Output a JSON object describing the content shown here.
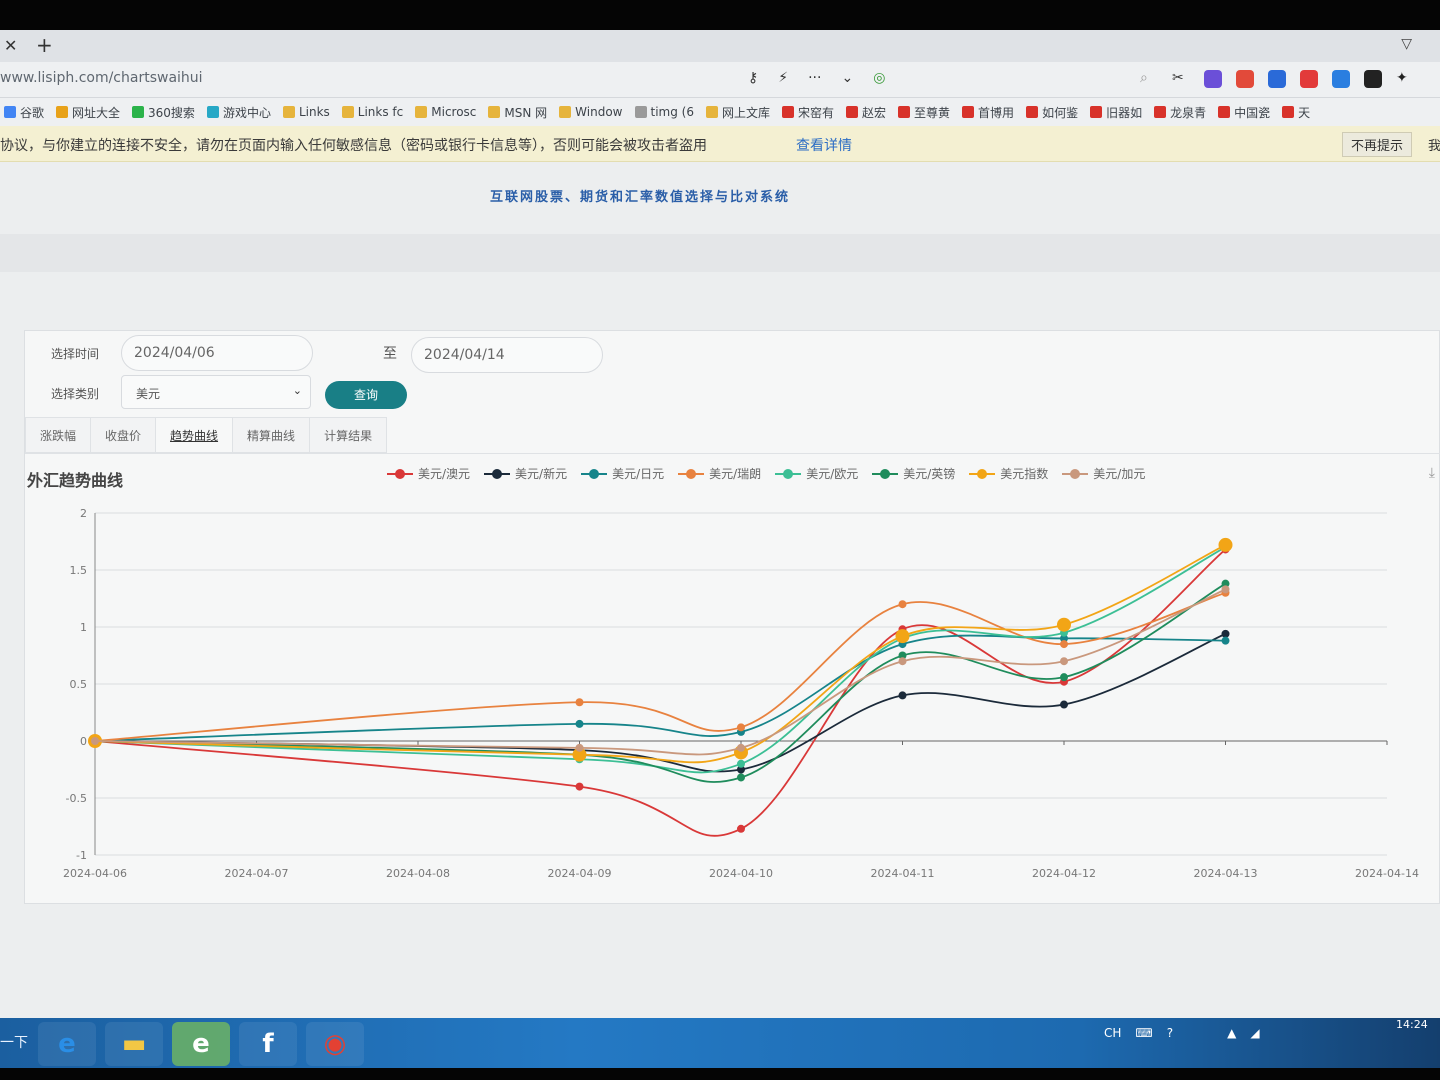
{
  "browser": {
    "url": "www.lisiph.com/chartswaihui",
    "new_tab": "+",
    "bookmarks": [
      {
        "label": "谷歌",
        "color": "#4285f4"
      },
      {
        "label": "网址大全",
        "color": "#e8a21a"
      },
      {
        "label": "360搜索",
        "color": "#2bb34a"
      },
      {
        "label": "游戏中心",
        "color": "#27a8c6"
      },
      {
        "label": "Links",
        "color": "#e6b43c"
      },
      {
        "label": "Links fc",
        "color": "#e6b43c"
      },
      {
        "label": "Microsc",
        "color": "#e6b43c"
      },
      {
        "label": "MSN 网",
        "color": "#e6b43c"
      },
      {
        "label": "Window",
        "color": "#e6b43c"
      },
      {
        "label": "timg (6",
        "color": "#9a9a9a"
      },
      {
        "label": "网上文库",
        "color": "#e6b43c"
      },
      {
        "label": "宋窑有",
        "color": "#d8322a"
      },
      {
        "label": "赵宏",
        "color": "#d8322a"
      },
      {
        "label": "至尊黄",
        "color": "#d8322a"
      },
      {
        "label": "首博用",
        "color": "#d8322a"
      },
      {
        "label": "如何鉴",
        "color": "#d8322a"
      },
      {
        "label": "旧器如",
        "color": "#d8322a"
      },
      {
        "label": "龙泉青",
        "color": "#d8322a"
      },
      {
        "label": "中国瓷",
        "color": "#d8322a"
      },
      {
        "label": "天",
        "color": "#d8322a"
      }
    ],
    "warning": {
      "text": "协议，与你建立的连接不安全，请勿在页面内输入任何敏感信息（密码或银行卡信息等），否则可能会被攻击者盗用",
      "link": "查看详情",
      "dismiss": "不再提示",
      "more": "我"
    }
  },
  "page": {
    "system_title": "互联网股票、期货和汇率数值选择与比对系统",
    "filters": {
      "time_label": "选择时间",
      "start_date": "2024/04/06",
      "to_label": "至",
      "end_date": "2024/04/14",
      "category_label": "选择类别",
      "category_value": "美元",
      "query_button": "查询"
    },
    "tabs": [
      "涨跌幅",
      "收盘价",
      "趋势曲线",
      "精算曲线",
      "计算结果"
    ],
    "active_tab": 2,
    "chart_title": "外汇趋势曲线"
  },
  "chart_data": {
    "type": "line",
    "title": "外汇趋势曲线",
    "x": [
      "2024-04-06",
      "2024-04-07",
      "2024-04-08",
      "2024-04-09",
      "2024-04-10",
      "2024-04-11",
      "2024-04-12",
      "2024-04-13",
      "2024-04-14"
    ],
    "ylim": [
      -1,
      2
    ],
    "yticks": [
      2,
      1.5,
      1,
      0.5,
      0,
      -0.5,
      -1
    ],
    "grid": true,
    "legend_position": "top",
    "series": [
      {
        "name": "美元/澳元",
        "color": "#d93838",
        "points": [
          [
            "2024-04-06",
            0
          ],
          [
            "2024-04-09",
            -0.4
          ],
          [
            "2024-04-10",
            -0.77
          ],
          [
            "2024-04-11",
            0.98
          ],
          [
            "2024-04-12",
            0.52
          ],
          [
            "2024-04-13",
            1.68
          ]
        ]
      },
      {
        "name": "美元/新元",
        "color": "#1b2a3a",
        "points": [
          [
            "2024-04-06",
            0
          ],
          [
            "2024-04-09",
            -0.08
          ],
          [
            "2024-04-10",
            -0.25
          ],
          [
            "2024-04-11",
            0.4
          ],
          [
            "2024-04-12",
            0.32
          ],
          [
            "2024-04-13",
            0.94
          ]
        ]
      },
      {
        "name": "美元/日元",
        "color": "#16848a",
        "points": [
          [
            "2024-04-06",
            0
          ],
          [
            "2024-04-09",
            0.15
          ],
          [
            "2024-04-10",
            0.08
          ],
          [
            "2024-04-11",
            0.85
          ],
          [
            "2024-04-12",
            0.9
          ],
          [
            "2024-04-13",
            0.88
          ]
        ]
      },
      {
        "name": "美元/瑞朗",
        "color": "#e8823f",
        "points": [
          [
            "2024-04-06",
            0
          ],
          [
            "2024-04-09",
            0.34
          ],
          [
            "2024-04-10",
            0.12
          ],
          [
            "2024-04-11",
            1.2
          ],
          [
            "2024-04-12",
            0.85
          ],
          [
            "2024-04-13",
            1.3
          ]
        ]
      },
      {
        "name": "美元/欧元",
        "color": "#3cbf95",
        "points": [
          [
            "2024-04-06",
            0
          ],
          [
            "2024-04-09",
            -0.16
          ],
          [
            "2024-04-10",
            -0.2
          ],
          [
            "2024-04-11",
            0.9
          ],
          [
            "2024-04-12",
            0.95
          ],
          [
            "2024-04-13",
            1.7
          ]
        ]
      },
      {
        "name": "美元/英镑",
        "color": "#1f8c5c",
        "points": [
          [
            "2024-04-06",
            0
          ],
          [
            "2024-04-09",
            -0.12
          ],
          [
            "2024-04-10",
            -0.32
          ],
          [
            "2024-04-11",
            0.75
          ],
          [
            "2024-04-12",
            0.56
          ],
          [
            "2024-04-13",
            1.38
          ]
        ]
      },
      {
        "name": "美元指数",
        "color": "#f2a516",
        "points": [
          [
            "2024-04-06",
            0
          ],
          [
            "2024-04-09",
            -0.12
          ],
          [
            "2024-04-10",
            -0.1
          ],
          [
            "2024-04-11",
            0.92
          ],
          [
            "2024-04-12",
            1.02
          ],
          [
            "2024-04-13",
            1.72
          ]
        ]
      },
      {
        "name": "美元/加元",
        "color": "#c9987d",
        "points": [
          [
            "2024-04-06",
            0
          ],
          [
            "2024-04-09",
            -0.06
          ],
          [
            "2024-04-10",
            -0.06
          ],
          [
            "2024-04-11",
            0.7
          ],
          [
            "2024-04-12",
            0.7
          ],
          [
            "2024-04-13",
            1.33
          ]
        ]
      }
    ]
  },
  "taskbar": {
    "start_label": "一下",
    "apps": [
      {
        "name": "ie",
        "glyph": "e",
        "color": "#2a8ee6"
      },
      {
        "name": "folder",
        "glyph": "▬",
        "color": "#f2c744"
      },
      {
        "name": "ie-green",
        "glyph": "e",
        "color": "#ffffff"
      },
      {
        "name": "flash",
        "glyph": "f",
        "color": "#ffffff"
      },
      {
        "name": "chrome",
        "glyph": "◉",
        "color": "#e34133"
      }
    ],
    "tray_lang": "CH",
    "clock": "14:24"
  }
}
